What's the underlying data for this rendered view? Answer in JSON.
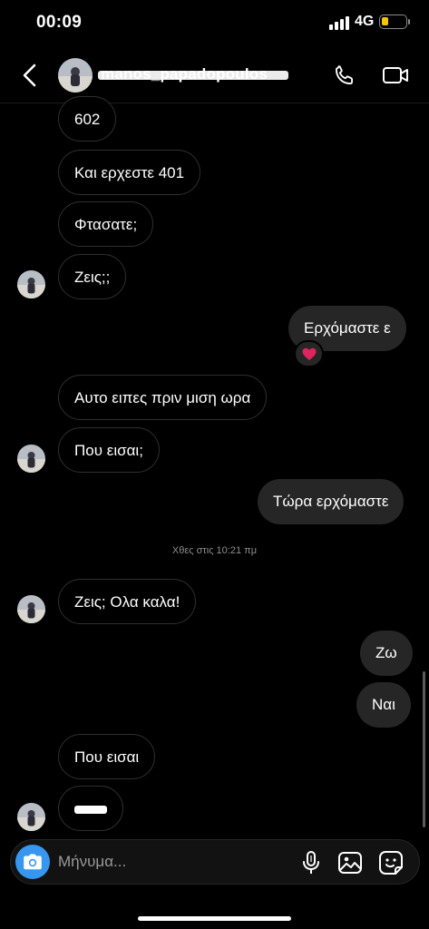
{
  "status_bar": {
    "time": "00:09",
    "network": "4G",
    "battery_level": 0.3,
    "battery_color": "#f7c600"
  },
  "header": {
    "username": "manos_papadopoulos",
    "back_icon": "chevron-left-icon",
    "call_icon": "phone-icon",
    "video_icon": "video-camera-icon"
  },
  "messages": [
    {
      "from": "them",
      "text": "602"
    },
    {
      "from": "them",
      "text": "Και ερχεστε 401"
    },
    {
      "from": "them",
      "text": "Φτασατε;"
    },
    {
      "from": "them",
      "text": "Ζεις;;"
    },
    {
      "from": "me",
      "text": "Ερχόμαστε ε",
      "reaction": "❤️"
    },
    {
      "from": "them",
      "text": "Αυτο ειπες πριν μιση ωρα"
    },
    {
      "from": "them",
      "text": "Που εισαι;"
    },
    {
      "from": "me",
      "text": "Τώρα ερχόμαστε"
    },
    {
      "from": "them",
      "text": "Ζεις; Ολα καλα!"
    },
    {
      "from": "me",
      "text": "Ζω"
    },
    {
      "from": "me",
      "text": "Ναι"
    },
    {
      "from": "them",
      "text": "Που εισαι"
    },
    {
      "from": "them",
      "text": ""
    }
  ],
  "timestamp": "Χθες στις 10:21 πμ",
  "composer": {
    "placeholder": "Μήνυμα...",
    "camera_icon": "camera-icon",
    "mic_icon": "microphone-icon",
    "gallery_icon": "image-icon",
    "sticker_icon": "sticker-icon"
  },
  "colors": {
    "accent": "#3797f0",
    "incoming_border": "#2f2f2f",
    "outgoing_bg": "#262626",
    "reaction_heart": "#e0245e"
  }
}
